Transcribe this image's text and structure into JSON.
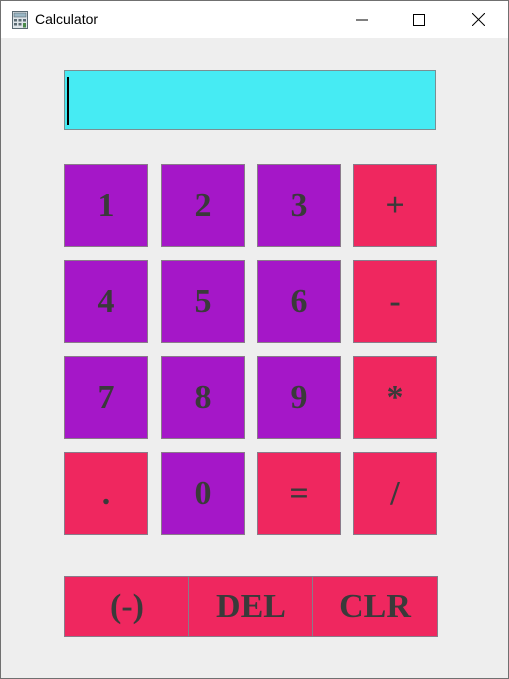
{
  "window": {
    "title": "Calculator",
    "controls": {
      "minimize": "minimize",
      "maximize": "maximize",
      "close": "close"
    }
  },
  "display": {
    "value": ""
  },
  "keys": {
    "k1": "1",
    "k2": "2",
    "k3": "3",
    "plus": "+",
    "k4": "4",
    "k5": "5",
    "k6": "6",
    "minus": "-",
    "k7": "7",
    "k8": "8",
    "k9": "9",
    "multiply": "*",
    "dot": ".",
    "k0": "0",
    "equals": "=",
    "divide": "/"
  },
  "bottom": {
    "negate": "(-)",
    "delete": "DEL",
    "clear": "CLR"
  },
  "colors": {
    "display": "#46ebf3",
    "digit_key": "#a517c8",
    "operator_key": "#ef275f",
    "key_text": "#3a3a3a",
    "background": "#eeeeee"
  }
}
